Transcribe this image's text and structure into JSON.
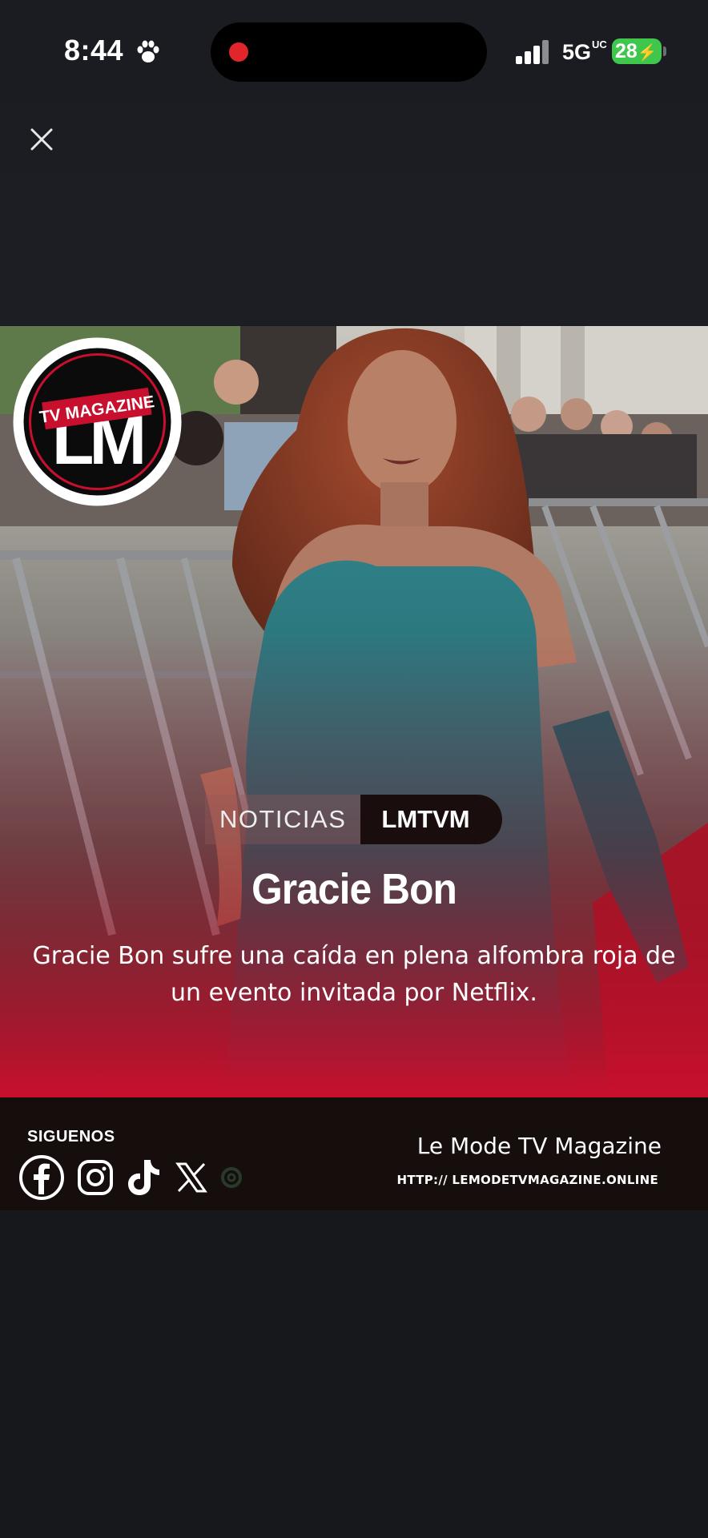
{
  "status_bar": {
    "time": "8:44",
    "network": "5G",
    "network_suffix": "UC",
    "battery": "28",
    "battery_color": "#3fc74d",
    "recording_color": "#e0262b"
  },
  "viewer": {
    "close_icon": "close-icon"
  },
  "post": {
    "logo": {
      "top_text": "TV MAGAZINE",
      "letters": "LM"
    },
    "tag_category": "NOTICIAS",
    "tag_brand": "LMTVM",
    "headline": "Gracie Bon",
    "summary": "Gracie Bon sufre una caída en plena alfombra roja de un evento invitada por Netflix.",
    "accent_color": "#c8102e"
  },
  "footer": {
    "follow_label": "SIGUENOS",
    "social_icons": [
      "facebook-icon",
      "instagram-icon",
      "tiktok-icon",
      "x-icon",
      "threads-icon"
    ],
    "brand_name": "Le Mode TV Magazine",
    "url": "HTTP:// LEMODETVMAGAZINE.ONLINE"
  }
}
